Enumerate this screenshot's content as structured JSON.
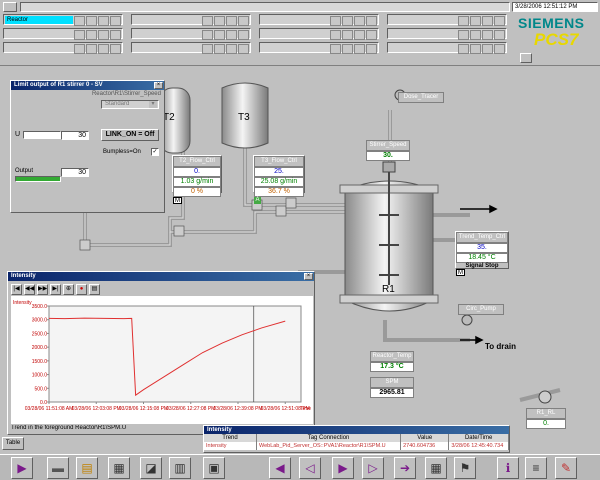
{
  "header": {
    "area_label": "Reactor",
    "datetime": "3/28/2006 12:51:12 PM",
    "brand": "SIEMENS",
    "product": "PCS7"
  },
  "faceplate": {
    "title": "Limit output of R1 stirrer 0 - SV",
    "path": "Reactor\\R1\\Stirrer_Speed",
    "mode": "Standard",
    "u_label": "U",
    "u_value": "30",
    "link_on": "LINK_ON = Off",
    "bumpless": "Bumpless=On",
    "output_label": "Output",
    "output_value": "30"
  },
  "process": {
    "tanks": [
      "T2",
      "T3",
      "R1"
    ],
    "dose_tracer": "Dose_Tracer",
    "stirrer_speed": {
      "tag": "Stirrer_Speed",
      "value": "30."
    },
    "t2_flow": {
      "tag": "T2_Flow_Ctrl",
      "sp": "0.",
      "pv": "1.03 g/min",
      "out": "0 %",
      "mode": "M"
    },
    "t3_flow": {
      "tag": "T3_Flow_Ctrl",
      "sp": "25.",
      "pv": "25.08 g/min",
      "out": "36.7 %",
      "mode": "A"
    },
    "temp_ctrl": {
      "tag": "Trend_Temp_Ctrl",
      "sp": "35.",
      "pv": "18.45 °C",
      "status": "Signal Stop",
      "mode": "M"
    },
    "circ_pump": "Circ_Pump",
    "to_drain": "To drain",
    "reactor_temp": {
      "tag": "Reactor_Temp",
      "value": "17.3 °C"
    },
    "spm": {
      "tag": "SPM",
      "value": "2965.81"
    },
    "r1_rl": {
      "tag": "R1_RL",
      "value": "0."
    }
  },
  "trend": {
    "title": "Intensity",
    "footer": "Trend in the foreground Reactor\\R1\\SPM.U",
    "chart_data": {
      "type": "line",
      "ylabel": "Intensity",
      "ylim": [
        0,
        3500
      ],
      "yticks": [
        "3500.0",
        "3000.0",
        "2500.0",
        "2000.0",
        "1500.0",
        "1000.0",
        "500.0",
        "0.0"
      ],
      "xticks": [
        {
          "date": "03/28/06",
          "time": "11:51:08 AM"
        },
        {
          "date": "03/28/06",
          "time": "12:03:08 PM"
        },
        {
          "date": "03/28/06",
          "time": "12:15:08 PM"
        },
        {
          "date": "03/28/06",
          "time": "12:27:08 PM"
        },
        {
          "date": "03/28/06",
          "time": "12:39:08 PM"
        },
        {
          "date": "03/28/06",
          "time": "12:51:08 PM"
        }
      ],
      "xlabel_end": "Time",
      "series": [
        {
          "color": "#e03030",
          "x": [
            "11:51",
            "11:55",
            "12:00",
            "12:05",
            "12:10",
            "12:12",
            "12:13",
            "12:15",
            "12:20",
            "12:25",
            "12:30",
            "12:35",
            "12:40",
            "12:45",
            "12:51"
          ],
          "values": [
            3050,
            3040,
            3060,
            3050,
            3040,
            3050,
            250,
            450,
            900,
            1350,
            1800,
            2150,
            2450,
            2700,
            2950
          ]
        }
      ]
    }
  },
  "trend_table": {
    "title": "Intensity",
    "headers": [
      "Trend",
      "Tag Connection",
      "Value",
      "Date/Time"
    ],
    "row": [
      "Intensity",
      "WebLab_Pid_Server_OS::PVA1\\Reactor\\R1\\SPM.U",
      "2740.604736",
      "3/28/06 12:45:40.734"
    ]
  },
  "table_tab": "Table"
}
